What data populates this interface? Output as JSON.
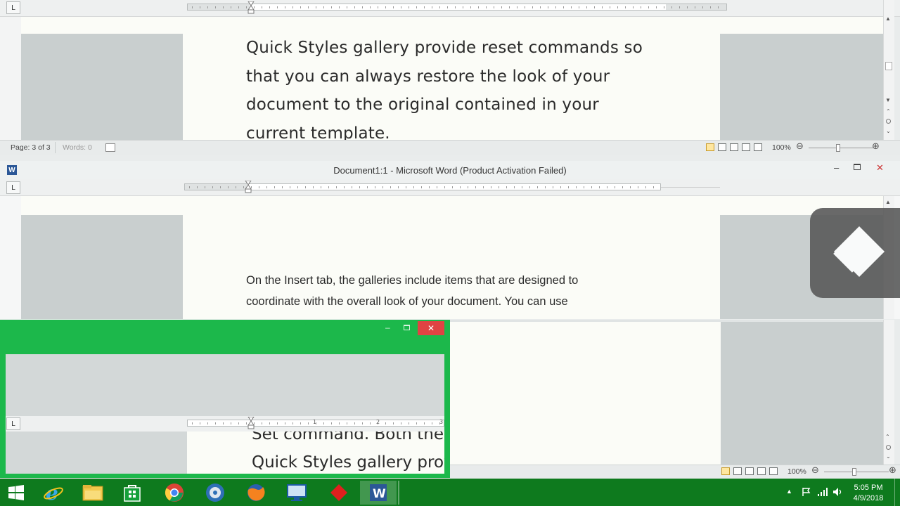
{
  "colors": {
    "accent_green": "#1cb84b",
    "taskbar_green": "#0e7a1e",
    "close_red": "#e04343",
    "word_blue": "#2b5797"
  },
  "window_top": {
    "doc_text_lines": [
      "Quick Styles gallery provide reset commands so",
      "that you can always restore the look of your",
      "document to the original contained in your",
      "current template."
    ],
    "status": {
      "page": "Page: 3 of 3",
      "words": "Words: 0",
      "zoom": "100%"
    }
  },
  "window_middle": {
    "title": "Document1:1 - Microsoft Word (Product Activation Failed)",
    "ruler_tab_label": "L",
    "doc_text_lines": [
      "On the Insert tab, the galleries include items that are designed to",
      "coordinate with the overall look of your document. You can use"
    ]
  },
  "window_small": {
    "ruler_tab_label": "L",
    "ruler_numbers": [
      "1",
      "2",
      "3"
    ],
    "doc_text_lines": [
      "Set command. Both the",
      "Quick Styles gallery prov"
    ]
  },
  "bottom_status": {
    "zoom": "100%"
  },
  "taskbar": {
    "apps": [
      "windows-start",
      "internet-explorer",
      "file-explorer",
      "store",
      "chrome",
      "media-app",
      "firefox",
      "remote-desktop",
      "red-app",
      "word"
    ],
    "clock_time": "5:05 PM",
    "clock_date": "4/9/2018"
  },
  "icons": {
    "ruler_tab_top": "L"
  }
}
